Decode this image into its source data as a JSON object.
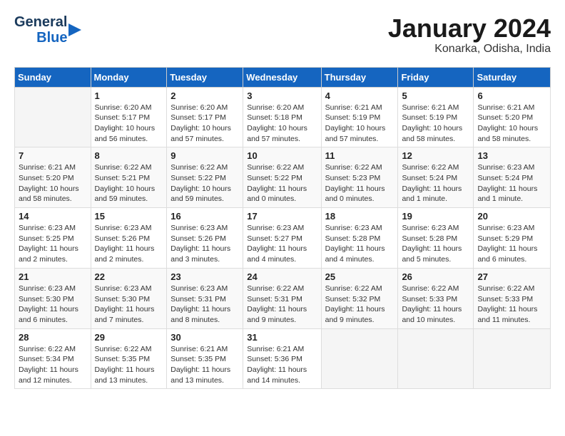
{
  "header": {
    "logo_line1": "General",
    "logo_line2": "Blue",
    "month": "January 2024",
    "location": "Konarka, Odisha, India"
  },
  "weekdays": [
    "Sunday",
    "Monday",
    "Tuesday",
    "Wednesday",
    "Thursday",
    "Friday",
    "Saturday"
  ],
  "weeks": [
    [
      {
        "day": "",
        "info": ""
      },
      {
        "day": "1",
        "info": "Sunrise: 6:20 AM\nSunset: 5:17 PM\nDaylight: 10 hours\nand 56 minutes."
      },
      {
        "day": "2",
        "info": "Sunrise: 6:20 AM\nSunset: 5:17 PM\nDaylight: 10 hours\nand 57 minutes."
      },
      {
        "day": "3",
        "info": "Sunrise: 6:20 AM\nSunset: 5:18 PM\nDaylight: 10 hours\nand 57 minutes."
      },
      {
        "day": "4",
        "info": "Sunrise: 6:21 AM\nSunset: 5:19 PM\nDaylight: 10 hours\nand 57 minutes."
      },
      {
        "day": "5",
        "info": "Sunrise: 6:21 AM\nSunset: 5:19 PM\nDaylight: 10 hours\nand 58 minutes."
      },
      {
        "day": "6",
        "info": "Sunrise: 6:21 AM\nSunset: 5:20 PM\nDaylight: 10 hours\nand 58 minutes."
      }
    ],
    [
      {
        "day": "7",
        "info": "Sunrise: 6:21 AM\nSunset: 5:20 PM\nDaylight: 10 hours\nand 58 minutes."
      },
      {
        "day": "8",
        "info": "Sunrise: 6:22 AM\nSunset: 5:21 PM\nDaylight: 10 hours\nand 59 minutes."
      },
      {
        "day": "9",
        "info": "Sunrise: 6:22 AM\nSunset: 5:22 PM\nDaylight: 10 hours\nand 59 minutes."
      },
      {
        "day": "10",
        "info": "Sunrise: 6:22 AM\nSunset: 5:22 PM\nDaylight: 11 hours\nand 0 minutes."
      },
      {
        "day": "11",
        "info": "Sunrise: 6:22 AM\nSunset: 5:23 PM\nDaylight: 11 hours\nand 0 minutes."
      },
      {
        "day": "12",
        "info": "Sunrise: 6:22 AM\nSunset: 5:24 PM\nDaylight: 11 hours\nand 1 minute."
      },
      {
        "day": "13",
        "info": "Sunrise: 6:23 AM\nSunset: 5:24 PM\nDaylight: 11 hours\nand 1 minute."
      }
    ],
    [
      {
        "day": "14",
        "info": "Sunrise: 6:23 AM\nSunset: 5:25 PM\nDaylight: 11 hours\nand 2 minutes."
      },
      {
        "day": "15",
        "info": "Sunrise: 6:23 AM\nSunset: 5:26 PM\nDaylight: 11 hours\nand 2 minutes."
      },
      {
        "day": "16",
        "info": "Sunrise: 6:23 AM\nSunset: 5:26 PM\nDaylight: 11 hours\nand 3 minutes."
      },
      {
        "day": "17",
        "info": "Sunrise: 6:23 AM\nSunset: 5:27 PM\nDaylight: 11 hours\nand 4 minutes."
      },
      {
        "day": "18",
        "info": "Sunrise: 6:23 AM\nSunset: 5:28 PM\nDaylight: 11 hours\nand 4 minutes."
      },
      {
        "day": "19",
        "info": "Sunrise: 6:23 AM\nSunset: 5:28 PM\nDaylight: 11 hours\nand 5 minutes."
      },
      {
        "day": "20",
        "info": "Sunrise: 6:23 AM\nSunset: 5:29 PM\nDaylight: 11 hours\nand 6 minutes."
      }
    ],
    [
      {
        "day": "21",
        "info": "Sunrise: 6:23 AM\nSunset: 5:30 PM\nDaylight: 11 hours\nand 6 minutes."
      },
      {
        "day": "22",
        "info": "Sunrise: 6:23 AM\nSunset: 5:30 PM\nDaylight: 11 hours\nand 7 minutes."
      },
      {
        "day": "23",
        "info": "Sunrise: 6:23 AM\nSunset: 5:31 PM\nDaylight: 11 hours\nand 8 minutes."
      },
      {
        "day": "24",
        "info": "Sunrise: 6:22 AM\nSunset: 5:31 PM\nDaylight: 11 hours\nand 9 minutes."
      },
      {
        "day": "25",
        "info": "Sunrise: 6:22 AM\nSunset: 5:32 PM\nDaylight: 11 hours\nand 9 minutes."
      },
      {
        "day": "26",
        "info": "Sunrise: 6:22 AM\nSunset: 5:33 PM\nDaylight: 11 hours\nand 10 minutes."
      },
      {
        "day": "27",
        "info": "Sunrise: 6:22 AM\nSunset: 5:33 PM\nDaylight: 11 hours\nand 11 minutes."
      }
    ],
    [
      {
        "day": "28",
        "info": "Sunrise: 6:22 AM\nSunset: 5:34 PM\nDaylight: 11 hours\nand 12 minutes."
      },
      {
        "day": "29",
        "info": "Sunrise: 6:22 AM\nSunset: 5:35 PM\nDaylight: 11 hours\nand 13 minutes."
      },
      {
        "day": "30",
        "info": "Sunrise: 6:21 AM\nSunset: 5:35 PM\nDaylight: 11 hours\nand 13 minutes."
      },
      {
        "day": "31",
        "info": "Sunrise: 6:21 AM\nSunset: 5:36 PM\nDaylight: 11 hours\nand 14 minutes."
      },
      {
        "day": "",
        "info": ""
      },
      {
        "day": "",
        "info": ""
      },
      {
        "day": "",
        "info": ""
      }
    ]
  ]
}
